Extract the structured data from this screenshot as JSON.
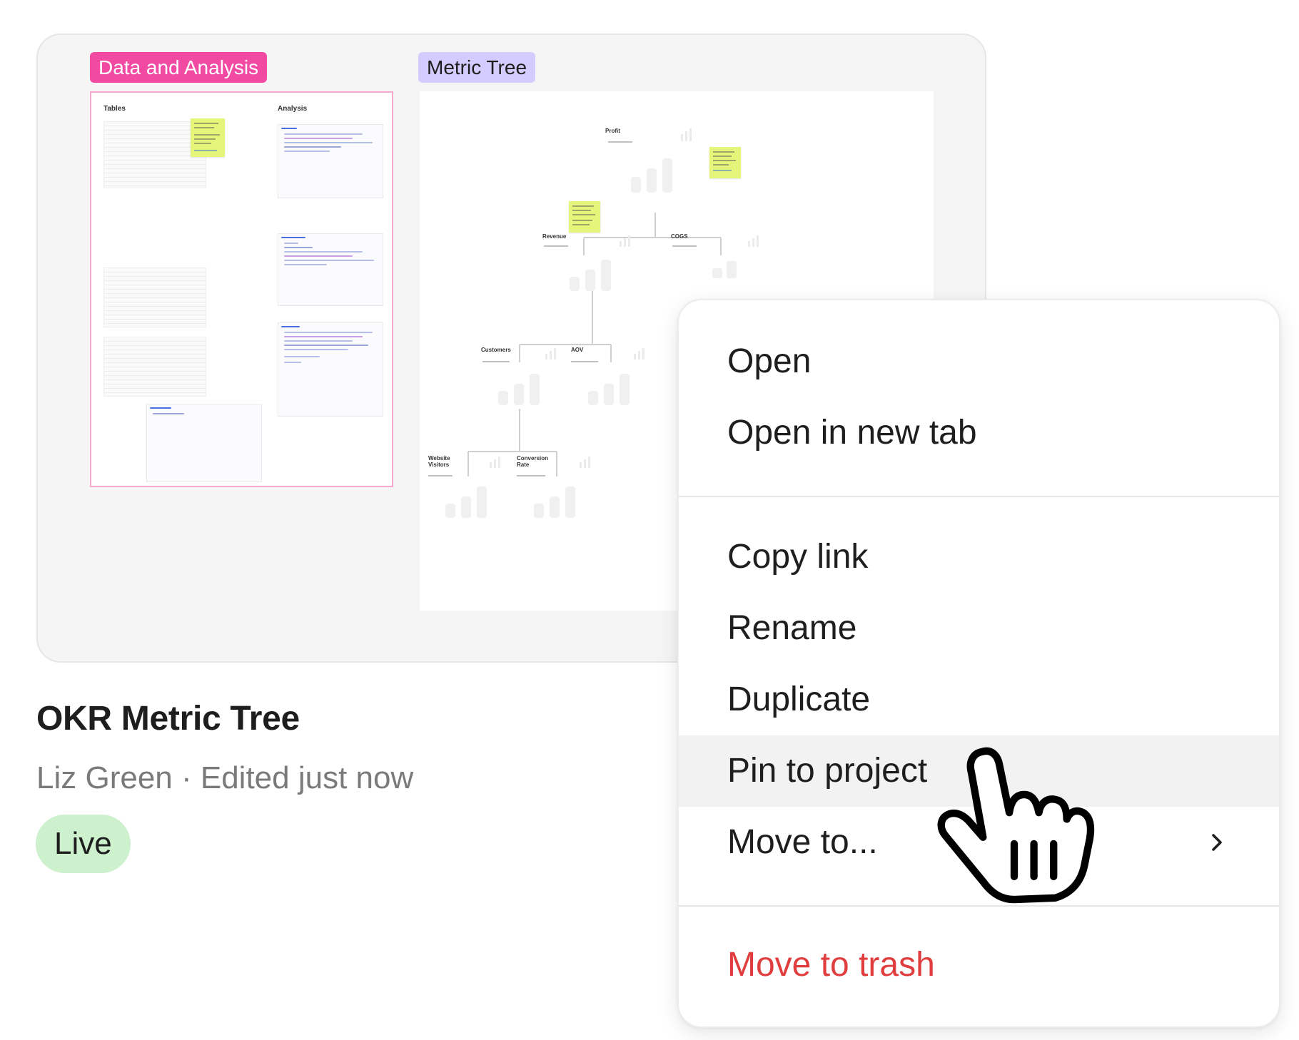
{
  "card": {
    "frames": [
      {
        "label": "Data and Analysis",
        "color": "#f24aa3"
      },
      {
        "label": "Metric Tree",
        "color": "#d4ccff"
      }
    ],
    "preview_a": {
      "tables_label": "Tables",
      "analysis_label": "Analysis"
    },
    "preview_b": {
      "nodes": {
        "profit": "Profit",
        "revenue": "Revenue",
        "cogs": "COGS",
        "customers": "Customers",
        "aov": "AOV",
        "website_visitors": "Website\nVisitors",
        "conversion_rate": "Conversion\nRate"
      }
    },
    "title": "OKR Metric Tree",
    "meta": "Liz Green · Edited just now",
    "status_badge": "Live"
  },
  "context_menu": {
    "items": [
      {
        "label": "Open"
      },
      {
        "label": "Open in new tab"
      },
      {
        "label": "Copy link"
      },
      {
        "label": "Rename"
      },
      {
        "label": "Duplicate"
      },
      {
        "label": "Pin to project",
        "state": "hovered"
      },
      {
        "label": "Move to...",
        "icon": "chevron-right-icon"
      },
      {
        "label": "Move to trash",
        "style": "danger"
      }
    ],
    "danger_color": "#e03e3e",
    "hover_bg": "#f2f2f2"
  },
  "cursor": {
    "icon": "hand-pointer-icon"
  }
}
